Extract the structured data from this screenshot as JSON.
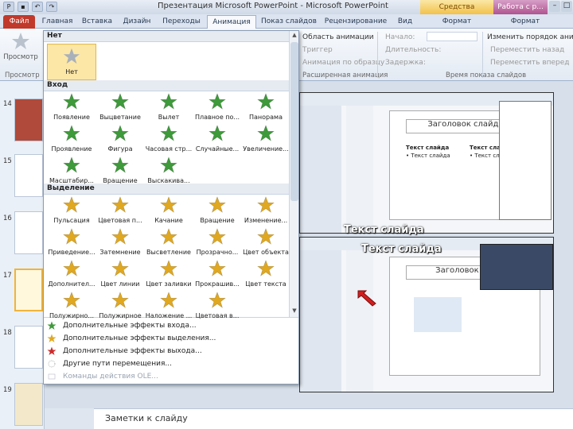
{
  "window": {
    "title": "Презентация Microsoft PowerPoint - Microsoft PowerPoint",
    "contextual_tabs": [
      "Средства рисования",
      "Работа с р..."
    ]
  },
  "tabs": [
    "Файл",
    "Главная",
    "Вставка",
    "Дизайн",
    "Переходы",
    "Анимация",
    "Показ слайдов",
    "Рецензирование",
    "Вид",
    "Формат",
    "Формат"
  ],
  "ribbon": {
    "preview_label": "Просмотр",
    "preview_group": "Просмотр",
    "area": "Область анимации",
    "trigger": "Триггер",
    "painter": "Анимация по образцу",
    "advanced_group": "Расширенная анимация",
    "start": "Начало:",
    "duration": "Длительность:",
    "delay": "Задержка:",
    "reorder": "Изменить порядок анимации",
    "move_earlier": "Переместить назад",
    "move_later": "Переместить вперед",
    "timing_group": "Время показа слайдов"
  },
  "thumbnails": [
    "14",
    "15",
    "16",
    "17",
    "18",
    "19"
  ],
  "gallery": {
    "none_header": "Нет",
    "none_item": "Нет",
    "entrance_header": "Вход",
    "entrance": [
      "Появление",
      "Выцветание",
      "Вылет",
      "Плавное по...",
      "Панорама",
      "Проявление",
      "Фигура",
      "Часовая стр...",
      "Случайные...",
      "Увеличение...",
      "Масштабир...",
      "Вращение",
      "Выскакива..."
    ],
    "emphasis_header": "Выделение",
    "emphasis": [
      "Пульсация",
      "Цветовая п...",
      "Качание",
      "Вращение",
      "Изменение...",
      "Приведение...",
      "Затемнение",
      "Высветление",
      "Прозрачно...",
      "Цвет объекта",
      "Дополнител...",
      "Цвет линии",
      "Цвет заливки",
      "Прокрашив...",
      "Цвет текста",
      "Полужирно...",
      "Полужирное",
      "Наложение ...",
      "Цветовая в..."
    ],
    "menu": [
      "Дополнительные эффекты входа...",
      "Дополнительные эффекты выделения...",
      "Дополнительные эффекты выхода...",
      "Другие пути перемещения...",
      "Команды действия OLE..."
    ]
  },
  "canvas": {
    "callout_top": "Текст слайда",
    "callout_bottom": "Текст слайда",
    "slide_title_top": "Заголовок слайда",
    "slide_title_bottom": "Заголовок сла",
    "slide_text_a": "Текст слайда",
    "slide_text_b": "Текст слайда",
    "bullet_a": "• Текст слайда",
    "bullet_b": "• Текст слайда"
  },
  "notes": {
    "placeholder": "Заметки к слайду"
  },
  "colors": {
    "star_green": "#3e9a3a",
    "star_gold": "#e0a820",
    "file_tab": "#c0392b",
    "selected": "#fce7a6"
  }
}
